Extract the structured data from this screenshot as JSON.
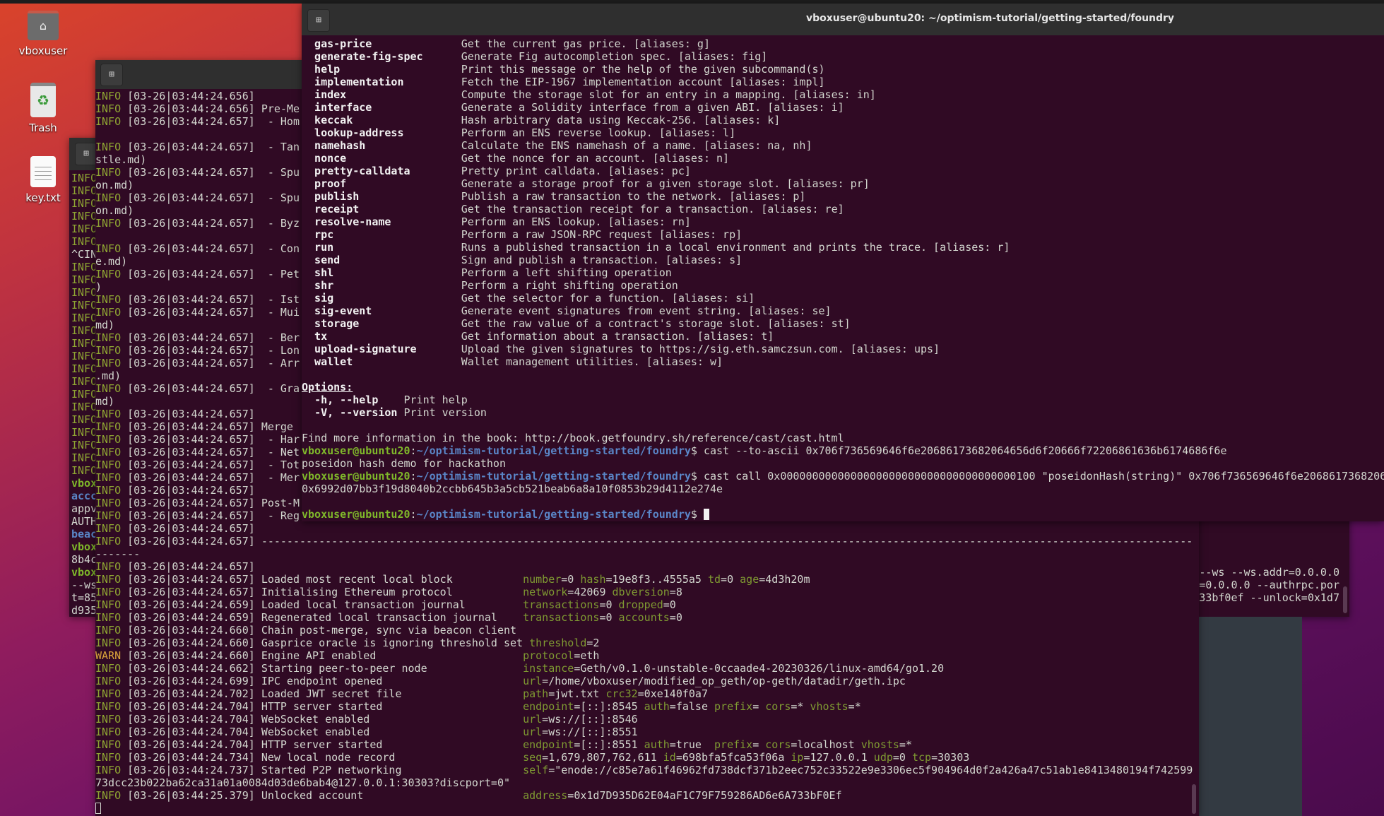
{
  "desktop": {
    "icons": [
      {
        "label": "vboxuser",
        "icon": "home-folder-icon"
      },
      {
        "label": "Trash",
        "icon": "trash-icon"
      },
      {
        "label": "key.txt",
        "icon": "text-file-icon"
      }
    ]
  },
  "colors": {
    "terminal_bg": "#300a24",
    "info": "#8fa633",
    "warn": "#d8a23a",
    "prompt_user": "#7fb82a",
    "prompt_path": "#5a86c8",
    "text": "#d3d7cf"
  },
  "back_terminal": {
    "left_fragments": [
      {
        "text": "INFO",
        "style": "info"
      },
      {
        "text": "INFO",
        "style": "info"
      },
      {
        "text": "INFO",
        "style": "info"
      },
      {
        "text": "INFO",
        "style": "info"
      },
      {
        "text": "INFO",
        "style": "info"
      },
      {
        "text": "INFO",
        "style": "info"
      },
      {
        "text": "^CIN",
        "style": "plain"
      },
      {
        "text": "INFO",
        "style": "info"
      },
      {
        "text": "INFO",
        "style": "info"
      },
      {
        "text": "INFO",
        "style": "info"
      },
      {
        "text": "INFO",
        "style": "info"
      },
      {
        "text": "INFO",
        "style": "info"
      },
      {
        "text": "INFO",
        "style": "info"
      },
      {
        "text": "INFO",
        "style": "info"
      },
      {
        "text": "INFO",
        "style": "info"
      },
      {
        "text": "INFO",
        "style": "info"
      },
      {
        "text": "INFO",
        "style": "info"
      },
      {
        "text": "INFO",
        "style": "info"
      },
      {
        "text": "INFO",
        "style": "info"
      },
      {
        "text": "INFO",
        "style": "info"
      },
      {
        "text": "INFO",
        "style": "info"
      },
      {
        "text": "INFO",
        "style": "info"
      },
      {
        "text": "INFO",
        "style": "info"
      },
      {
        "text": "INFO",
        "style": "info"
      },
      {
        "text": "vbox",
        "style": "user"
      },
      {
        "text": "accc",
        "style": "blue"
      },
      {
        "text": "appv",
        "style": "plain"
      },
      {
        "text": "AUTH",
        "style": "plain"
      },
      {
        "text": "beac",
        "style": "blue"
      },
      {
        "text": "vbox",
        "style": "user"
      },
      {
        "text": "8b4c",
        "style": "plain"
      },
      {
        "text": "vbox",
        "style": "user"
      },
      {
        "text": "--ws",
        "style": "plain"
      },
      {
        "text": "t=85",
        "style": "plain"
      },
      {
        "text": "d935",
        "style": "plain"
      }
    ],
    "right_fragments": [
      {
        "row": 31,
        "text": "--ws --ws.addr=0.0.0.0"
      },
      {
        "row": 32,
        "text": "r=0.0.0.0 --authrpc.por"
      },
      {
        "row": 33,
        "text": "733bf0ef --unlock=0x1d7"
      }
    ]
  },
  "log_terminal": {
    "lines": [
      {
        "lvl": "INFO",
        "ts": "[03-26|03:44:24.656]",
        "msg": ""
      },
      {
        "lvl": "INFO",
        "ts": "[03-26|03:44:24.656]",
        "msg": "Pre-Me"
      },
      {
        "lvl": "INFO",
        "ts": "[03-26|03:44:24.657]",
        "msg": " - Hom"
      },
      {
        "raw": ""
      },
      {
        "lvl": "INFO",
        "ts": "[03-26|03:44:24.657]",
        "msg": " - Tan"
      },
      {
        "raw": "stle.md)"
      },
      {
        "lvl": "INFO",
        "ts": "[03-26|03:44:24.657]",
        "msg": " - Spu"
      },
      {
        "raw": "on.md)"
      },
      {
        "lvl": "INFO",
        "ts": "[03-26|03:44:24.657]",
        "msg": " - Spu"
      },
      {
        "raw": "on.md)"
      },
      {
        "lvl": "INFO",
        "ts": "[03-26|03:44:24.657]",
        "msg": " - Byz"
      },
      {
        "raw": ""
      },
      {
        "lvl": "INFO",
        "ts": "[03-26|03:44:24.657]",
        "msg": " - Con"
      },
      {
        "raw": "e.md)"
      },
      {
        "lvl": "INFO",
        "ts": "[03-26|03:44:24.657]",
        "msg": " - Pet"
      },
      {
        "raw": ")"
      },
      {
        "lvl": "INFO",
        "ts": "[03-26|03:44:24.657]",
        "msg": " - Ist"
      },
      {
        "lvl": "INFO",
        "ts": "[03-26|03:44:24.657]",
        "msg": " - Mui"
      },
      {
        "raw": "md)"
      },
      {
        "lvl": "INFO",
        "ts": "[03-26|03:44:24.657]",
        "msg": " - Ber"
      },
      {
        "lvl": "INFO",
        "ts": "[03-26|03:44:24.657]",
        "msg": " - Lon"
      },
      {
        "lvl": "INFO",
        "ts": "[03-26|03:44:24.657]",
        "msg": " - Arr"
      },
      {
        "raw": ".md)"
      },
      {
        "lvl": "INFO",
        "ts": "[03-26|03:44:24.657]",
        "msg": " - Gra"
      },
      {
        "raw": "md)"
      },
      {
        "lvl": "INFO",
        "ts": "[03-26|03:44:24.657]",
        "msg": ""
      },
      {
        "lvl": "INFO",
        "ts": "[03-26|03:44:24.657]",
        "msg": "Merge "
      },
      {
        "lvl": "INFO",
        "ts": "[03-26|03:44:24.657]",
        "msg": " - Har"
      },
      {
        "lvl": "INFO",
        "ts": "[03-26|03:44:24.657]",
        "msg": " - Net"
      },
      {
        "lvl": "INFO",
        "ts": "[03-26|03:44:24.657]",
        "msg": " - Tot"
      },
      {
        "lvl": "INFO",
        "ts": "[03-26|03:44:24.657]",
        "msg": " - Mer"
      },
      {
        "lvl": "INFO",
        "ts": "[03-26|03:44:24.657]",
        "msg": ""
      },
      {
        "lvl": "INFO",
        "ts": "[03-26|03:44:24.657]",
        "msg": "Post-M"
      },
      {
        "lvl": "INFO",
        "ts": "[03-26|03:44:24.657]",
        "msg": " - Reg"
      },
      {
        "lvl": "INFO",
        "ts": "[03-26|03:44:24.657]",
        "msg": ""
      },
      {
        "lvl": "INFO",
        "ts": "[03-26|03:44:24.657]",
        "msg": "--------------------------------------------------------------------------------------------------------------------------------------------------"
      },
      {
        "raw": "-------"
      },
      {
        "lvl": "INFO",
        "ts": "[03-26|03:44:24.657]",
        "msg": ""
      },
      {
        "lvl": "INFO",
        "ts": "[03-26|03:44:24.657]",
        "msg": "Loaded most recent local block",
        "kv": [
          [
            "number",
            "0"
          ],
          [
            "hash",
            "19e8f3..4555a5"
          ],
          [
            "td",
            "0"
          ],
          [
            "age",
            "4d3h20m"
          ]
        ]
      },
      {
        "lvl": "INFO",
        "ts": "[03-26|03:44:24.657]",
        "msg": "Initialising Ethereum protocol",
        "kv": [
          [
            "network",
            "42069"
          ],
          [
            "dbversion",
            "8"
          ]
        ]
      },
      {
        "lvl": "INFO",
        "ts": "[03-26|03:44:24.659]",
        "msg": "Loaded local transaction journal",
        "kv": [
          [
            "transactions",
            "0"
          ],
          [
            "dropped",
            "0"
          ]
        ]
      },
      {
        "lvl": "INFO",
        "ts": "[03-26|03:44:24.659]",
        "msg": "Regenerated local transaction journal",
        "kv": [
          [
            "transactions",
            "0"
          ],
          [
            "accounts",
            "0"
          ]
        ]
      },
      {
        "lvl": "INFO",
        "ts": "[03-26|03:44:24.660]",
        "msg": "Chain post-merge, sync via beacon client"
      },
      {
        "lvl": "INFO",
        "ts": "[03-26|03:44:24.660]",
        "msg": "Gasprice oracle is ignoring threshold set",
        "kv": [
          [
            "threshold",
            "2"
          ]
        ]
      },
      {
        "lvl": "WARN",
        "ts": "[03-26|03:44:24.660]",
        "msg": "Engine API enabled",
        "kv": [
          [
            "protocol",
            "eth"
          ]
        ]
      },
      {
        "lvl": "INFO",
        "ts": "[03-26|03:44:24.662]",
        "msg": "Starting peer-to-peer node",
        "kv": [
          [
            "instance",
            "Geth/v0.1.0-unstable-0ccaade4-20230326/linux-amd64/go1.20"
          ]
        ]
      },
      {
        "lvl": "INFO",
        "ts": "[03-26|03:44:24.699]",
        "msg": "IPC endpoint opened",
        "kv": [
          [
            "url",
            "/home/vboxuser/modified_op_geth/op-geth/datadir/geth.ipc"
          ]
        ]
      },
      {
        "lvl": "INFO",
        "ts": "[03-26|03:44:24.702]",
        "msg": "Loaded JWT secret file",
        "kv": [
          [
            "path",
            "jwt.txt"
          ],
          [
            "crc32",
            "0xe140f0a7"
          ]
        ]
      },
      {
        "lvl": "INFO",
        "ts": "[03-26|03:44:24.704]",
        "msg": "HTTP server started",
        "kv": [
          [
            "endpoint",
            "[::]:8545"
          ],
          [
            "auth",
            "false"
          ],
          [
            "prefix",
            ""
          ],
          [
            "cors",
            "*"
          ],
          [
            "vhosts",
            "*"
          ]
        ]
      },
      {
        "lvl": "INFO",
        "ts": "[03-26|03:44:24.704]",
        "msg": "WebSocket enabled",
        "kv": [
          [
            "url",
            "ws://[::]:8546"
          ]
        ]
      },
      {
        "lvl": "INFO",
        "ts": "[03-26|03:44:24.704]",
        "msg": "WebSocket enabled",
        "kv": [
          [
            "url",
            "ws://[::]:8551"
          ]
        ]
      },
      {
        "lvl": "INFO",
        "ts": "[03-26|03:44:24.704]",
        "msg": "HTTP server started",
        "kv": [
          [
            "endpoint",
            "[::]:8551"
          ],
          [
            "auth",
            "true "
          ],
          [
            "prefix",
            ""
          ],
          [
            "cors",
            "localhost"
          ],
          [
            "vhosts",
            "*"
          ]
        ]
      },
      {
        "lvl": "INFO",
        "ts": "[03-26|03:44:24.734]",
        "msg": "New local node record",
        "kv": [
          [
            "seq",
            "1,679,807,762,611"
          ],
          [
            "id",
            "698bfa5fca53f06a"
          ],
          [
            "ip",
            "127.0.0.1"
          ],
          [
            "udp",
            "0"
          ],
          [
            "tcp",
            "30303"
          ]
        ]
      },
      {
        "lvl": "INFO",
        "ts": "[03-26|03:44:24.737]",
        "msg": "Started P2P networking",
        "kv": [
          [
            "self",
            "\"enode://c85e7a61f46962fd738dcf371b2eec752c33522e9e3306ec5f904964d0f2a426a47c51ab1e8413480194f742599"
          ]
        ]
      },
      {
        "raw": "73dcc23b022ba62ca31a01a0084d03de6bab4@127.0.0.1:30303?discport=0\""
      },
      {
        "lvl": "INFO",
        "ts": "[03-26|03:44:25.379]",
        "msg": "Unlocked account",
        "kv": [
          [
            "address",
            "0x1d7D935D62E04aF1C79F759286AD6e6A733bF0Ef"
          ]
        ]
      },
      {
        "cursor": true
      }
    ]
  },
  "cast_terminal": {
    "title": "vboxuser@ubuntu20: ~/optimism-tutorial/getting-started/foundry",
    "commands": [
      {
        "name": "gas-price",
        "desc": "Get the current gas price. [aliases: g]"
      },
      {
        "name": "generate-fig-spec",
        "desc": "Generate Fig autocompletion spec. [aliases: fig]"
      },
      {
        "name": "help",
        "desc": "Print this message or the help of the given subcommand(s)"
      },
      {
        "name": "implementation",
        "desc": "Fetch the EIP-1967 implementation account [aliases: impl]"
      },
      {
        "name": "index",
        "desc": "Compute the storage slot for an entry in a mapping. [aliases: in]"
      },
      {
        "name": "interface",
        "desc": "Generate a Solidity interface from a given ABI. [aliases: i]"
      },
      {
        "name": "keccak",
        "desc": "Hash arbitrary data using Keccak-256. [aliases: k]"
      },
      {
        "name": "lookup-address",
        "desc": "Perform an ENS reverse lookup. [aliases: l]"
      },
      {
        "name": "namehash",
        "desc": "Calculate the ENS namehash of a name. [aliases: na, nh]"
      },
      {
        "name": "nonce",
        "desc": "Get the nonce for an account. [aliases: n]"
      },
      {
        "name": "pretty-calldata",
        "desc": "Pretty print calldata. [aliases: pc]"
      },
      {
        "name": "proof",
        "desc": "Generate a storage proof for a given storage slot. [aliases: pr]"
      },
      {
        "name": "publish",
        "desc": "Publish a raw transaction to the network. [aliases: p]"
      },
      {
        "name": "receipt",
        "desc": "Get the transaction receipt for a transaction. [aliases: re]"
      },
      {
        "name": "resolve-name",
        "desc": "Perform an ENS lookup. [aliases: rn]"
      },
      {
        "name": "rpc",
        "desc": "Perform a raw JSON-RPC request [aliases: rp]"
      },
      {
        "name": "run",
        "desc": "Runs a published transaction in a local environment and prints the trace. [aliases: r]"
      },
      {
        "name": "send",
        "desc": "Sign and publish a transaction. [aliases: s]"
      },
      {
        "name": "shl",
        "desc": "Perform a left shifting operation"
      },
      {
        "name": "shr",
        "desc": "Perform a right shifting operation"
      },
      {
        "name": "sig",
        "desc": "Get the selector for a function. [aliases: si]"
      },
      {
        "name": "sig-event",
        "desc": "Generate event signatures from event string. [aliases: se]"
      },
      {
        "name": "storage",
        "desc": "Get the raw value of a contract's storage slot. [aliases: st]"
      },
      {
        "name": "tx",
        "desc": "Get information about a transaction. [aliases: t]"
      },
      {
        "name": "upload-signature",
        "desc": "Upload the given signatures to https://sig.eth.samczsun.com. [aliases: ups]"
      },
      {
        "name": "wallet",
        "desc": "Wallet management utilities. [aliases: w]"
      }
    ],
    "options_heading": "Options:",
    "options": [
      {
        "flag": "-h, --help",
        "desc": "Print help"
      },
      {
        "flag": "-V, --version",
        "desc": "Print version"
      }
    ],
    "footer": "Find more information in the book: http://book.getfoundry.sh/reference/cast/cast.html",
    "prompt": {
      "user": "vboxuser@ubuntu20",
      "path": "~/optimism-tutorial/getting-started/foundry"
    },
    "history": [
      {
        "command": "cast --to-ascii 0x706f736569646f6e20686173682064656d6f20666f72206861636b6174686f6e"
      },
      {
        "output": "poseidon hash demo for hackathon"
      },
      {
        "command": "cast call 0x0000000000000000000000000000000000000100 \"poseidonHash(string)\" 0x706f736569646f6e2068617368206"
      },
      {
        "output": "0x6992d07bb3f19d8040b2ccbb645b3a5cb521beab6a8a10f0853b29d4112e274e"
      },
      {
        "output": ""
      },
      {
        "command": "",
        "cursor": true
      }
    ]
  }
}
